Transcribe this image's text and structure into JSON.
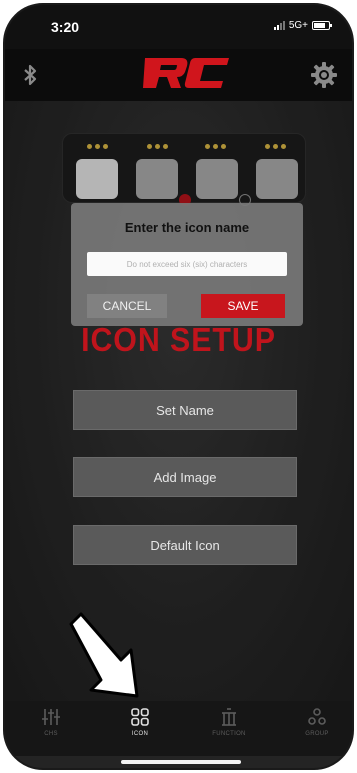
{
  "status_bar": {
    "time": "3:20",
    "network": "5G+"
  },
  "header": {
    "logo_text": "RC"
  },
  "dialog": {
    "title": "Enter the icon name",
    "input_value": "",
    "input_placeholder": "Do not exceed six (six) characters",
    "cancel_label": "CANCEL",
    "save_label": "SAVE"
  },
  "screen_title": "ICON SETUP",
  "menu": [
    {
      "label": "Set Name"
    },
    {
      "label": "Add Image"
    },
    {
      "label": "Default Icon"
    }
  ],
  "tabs": [
    {
      "label": "CHS",
      "icon": "sliders-icon",
      "active": false
    },
    {
      "label": "ICON",
      "icon": "grid-icon",
      "active": true
    },
    {
      "label": "FUNCTION",
      "icon": "function-icon",
      "active": false
    },
    {
      "label": "GROUP",
      "icon": "group-icon",
      "active": false
    }
  ],
  "colors": {
    "accent": "#c8161d",
    "background": "#2a2a2a"
  }
}
